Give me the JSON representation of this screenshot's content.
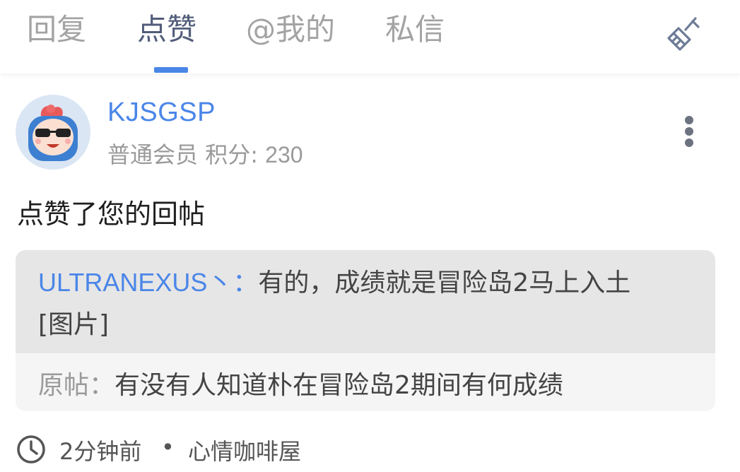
{
  "tabs": [
    {
      "label": "回复",
      "active": false
    },
    {
      "label": "点赞",
      "active": true
    },
    {
      "label": "@我的",
      "active": false
    },
    {
      "label": "私信",
      "active": false
    }
  ],
  "toolbar": {
    "clear_icon": "broom-icon"
  },
  "colors": {
    "accent": "#4a86e8",
    "active_tab": "#525d7a",
    "muted": "#a3a3a3",
    "quote_bg": "#e6e6e6",
    "orig_bg": "#f5f5f5"
  },
  "notification": {
    "username": "KJSGSP",
    "role": "普通会员",
    "score_label": "积分:",
    "score_value": "230",
    "action": "点赞了您的回帖",
    "quote": {
      "author": "ULTRANEXUS丶",
      "separator": "：",
      "text_line1": "有的，成绩就是冒险岛2马上入土",
      "text_line2": "[图片]",
      "orig_label": "原帖：",
      "orig_text": "有没有人知道朴在冒险岛2期间有何成绩"
    },
    "time": "2分钟前",
    "separator_dot": "•",
    "forum": "心情咖啡屋"
  }
}
